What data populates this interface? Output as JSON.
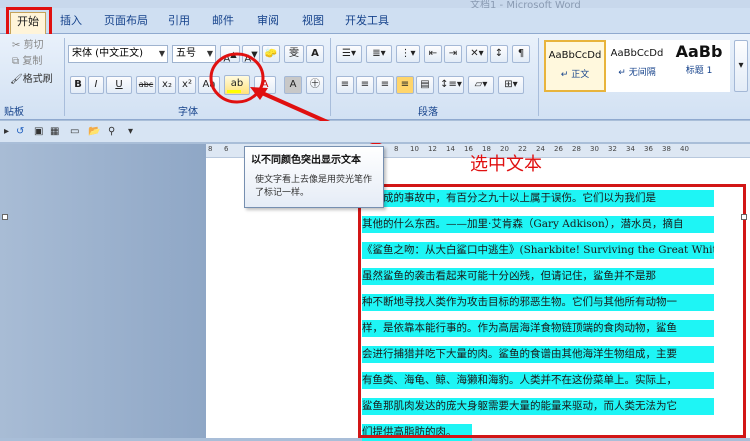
{
  "window": {
    "title": "文档1 - Microsoft Word"
  },
  "tabs": [
    "开始",
    "插入",
    "页面布局",
    "引用",
    "邮件",
    "审阅",
    "视图",
    "开发工具"
  ],
  "clipboard": {
    "cut": "剪切",
    "copy": "复制",
    "format_painter": "格式刷",
    "label": "贴板"
  },
  "font": {
    "name": "宋体 (中文正文)",
    "size": "五号",
    "label": "字体",
    "buttons": [
      "B",
      "I",
      "U",
      "abc",
      "x₂",
      "x²",
      "Aa",
      "A"
    ]
  },
  "paragraph": {
    "label": "段落"
  },
  "styles": [
    {
      "preview": "AaBbCcDd",
      "name": "↵ 正文",
      "selected": true
    },
    {
      "preview": "AaBbCcDd",
      "name": "↵ 无间隔",
      "selected": false
    },
    {
      "preview": "AaBb",
      "name": "标题 1",
      "selected": false
    }
  ],
  "tooltip": {
    "title": "以不同颜色突出显示文本",
    "body": "使文字看上去像是用荧光笔作了标记一样。"
  },
  "annotation": "选中文本",
  "ruler_ticks": [
    "8",
    "6",
    "4",
    "2",
    "2",
    "4",
    "6",
    "8",
    "10",
    "12",
    "14",
    "16",
    "18",
    "20",
    "22",
    "24",
    "26",
    "28",
    "30",
    "32",
    "34",
    "36",
    "38",
    "40"
  ],
  "document_lines": [
    "鱼造成的事故中，有百分之九十以上属于误伤。它们以为我们是",
    "其他的什么东西。——加里·艾肯森（Gary Adkison），潜水员，摘自",
    "《鲨鱼之吻：从大白鲨口中逃生》(Sharkbite! Surviving the Great White)",
    "    虽然鲨鱼的袭击看起来可能十分凶残，但请记住，鲨鱼并不是那",
    "种不断地寻找人类作为攻击目标的邪恶生物。它们与其他所有动物一",
    "样，是依靠本能行事的。作为高居海洋食物链顶端的食肉动物，鲨鱼",
    "会进行捕猎并吃下大量的肉。鲨鱼的食谱由其他海洋生物组成，主要",
    "有鱼类、海龟、鲸、海獭和海豹。人类并不在这份菜单上。实际上，",
    "鲨鱼那肌肉发达的庞大身躯需要大量的能量来驱动，而人类无法为它",
    "们提供高脂肪的肉。"
  ],
  "colors": {
    "highlight": "#1ef5f5",
    "annotation_red": "#e01010",
    "ribbon": "#d2e1f3"
  }
}
